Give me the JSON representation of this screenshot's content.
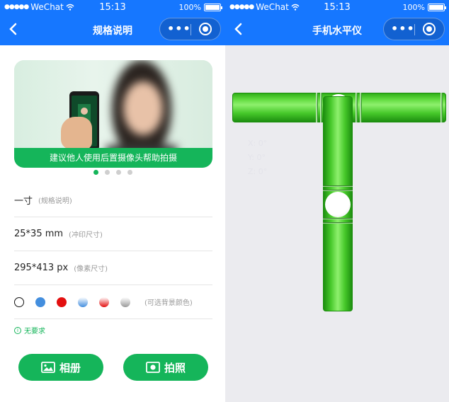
{
  "left_screen": {
    "status": {
      "carrier": "WeChat",
      "time": "15:13",
      "battery": "100%"
    },
    "nav": {
      "title": "规格说明"
    },
    "banner": {
      "caption": "建议他人使用后置摄像头帮助拍摄",
      "slides": 4,
      "active_slide": 1
    },
    "specs": [
      {
        "main": "一寸",
        "sub": "(规格说明)"
      },
      {
        "main": "25*35 mm",
        "sub": "(冲印尺寸)"
      },
      {
        "main": "295*413 px",
        "sub": "(像素尺寸)"
      }
    ],
    "bg_colors": {
      "label": "(可选背景颜色)",
      "swatches": [
        "#ffffff",
        "#438ede",
        "#e31010",
        "gradient-blue",
        "gradient-red",
        "gradient-gray"
      ]
    },
    "requirement": "无要求",
    "buttons": {
      "album": "相册",
      "camera": "拍照"
    }
  },
  "right_screen": {
    "status": {
      "carrier": "WeChat",
      "time": "15:13",
      "battery": "100%"
    },
    "nav": {
      "title": "手机水平仪"
    },
    "readout": {
      "x": "X: 0°",
      "y": "Y: 0°",
      "z": "Z: 0°"
    }
  },
  "colors": {
    "brand_blue": "#1677ff",
    "green": "#15b55a",
    "level_green": "#46c82a"
  }
}
